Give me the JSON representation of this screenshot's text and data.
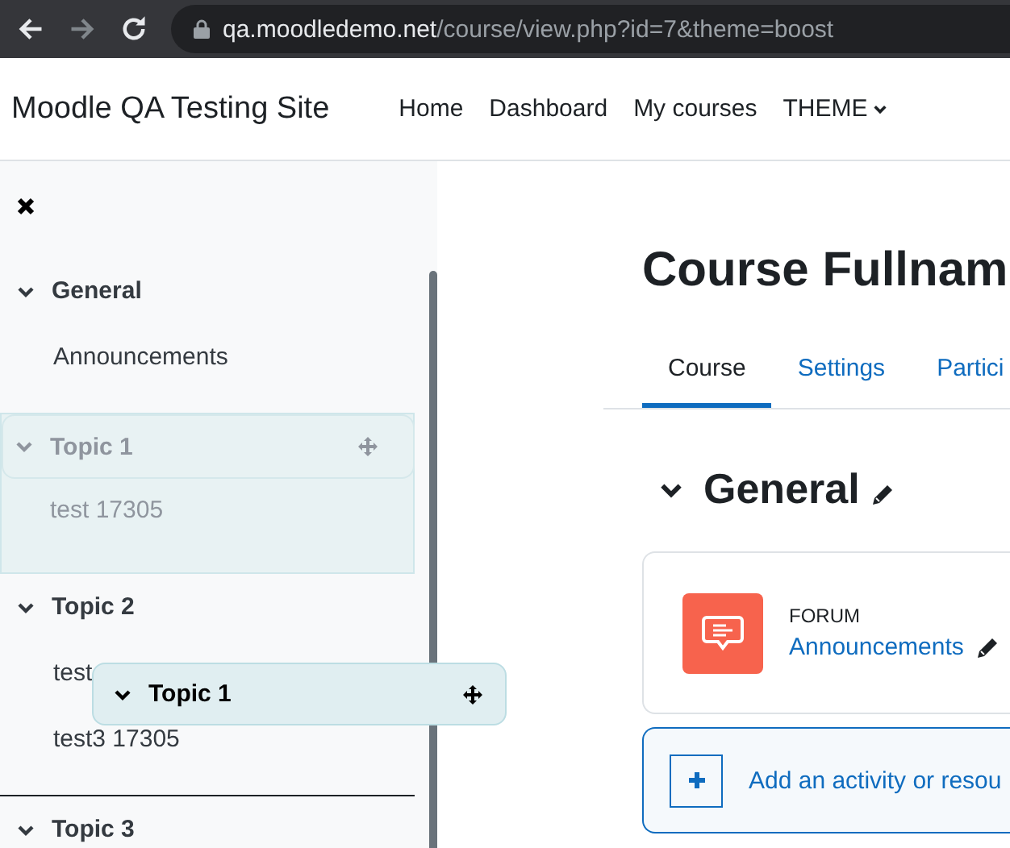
{
  "browser": {
    "url_host": "qa.moodledemo.net",
    "url_path": "/course/view.php?id=7&theme=boost"
  },
  "navbar": {
    "site_name": "Moodle QA Testing Site",
    "items": [
      {
        "label": "Home",
        "kind": "link"
      },
      {
        "label": "Dashboard",
        "kind": "link"
      },
      {
        "label": "My courses",
        "kind": "link"
      },
      {
        "label": "THEME",
        "kind": "dropdown"
      }
    ]
  },
  "course_index": {
    "sections": [
      {
        "title": "General",
        "kind": "section",
        "expanded": true,
        "drop_before": false,
        "activities": [
          "Announcements"
        ]
      },
      {
        "title": "Topic 1",
        "kind": "drag_source",
        "expanded": true,
        "drop_before": false,
        "activities": [
          "test 17305"
        ]
      },
      {
        "title": "Topic 2",
        "kind": "section",
        "expanded": true,
        "drop_before": false,
        "activities": [
          "test",
          "test3 17305"
        ]
      },
      {
        "title": "Topic 3",
        "kind": "section",
        "expanded": true,
        "drop_before": true
      }
    ],
    "drag_proxy": {
      "title": "Topic 1",
      "expanded": true
    }
  },
  "course": {
    "title": "Course Fullnam",
    "tabs": [
      {
        "label": "Course",
        "selected": true
      },
      {
        "label": "Settings",
        "selected": false
      },
      {
        "label": "Partici",
        "selected": false
      }
    ],
    "section": {
      "title": "General",
      "expanded": true,
      "activities": [
        {
          "type": "FORUM",
          "name": "Announcements"
        }
      ]
    },
    "add_activity": "Add an activity or resou"
  }
}
